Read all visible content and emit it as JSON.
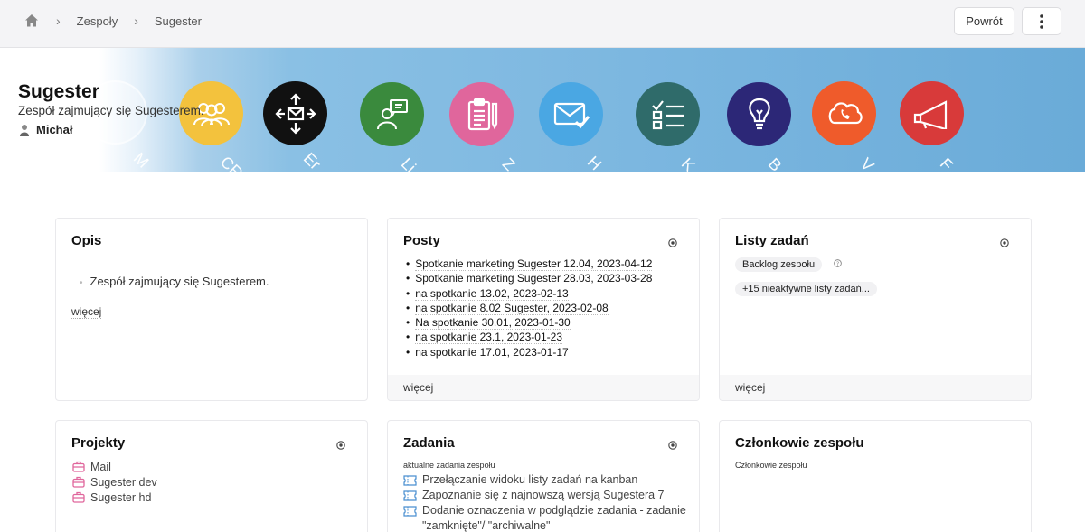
{
  "breadcrumb": {
    "home_icon": "home-icon",
    "items": [
      "Zespoły",
      "Sugester"
    ]
  },
  "toolbar": {
    "back_label": "Powrót",
    "more_icon": "more-vertical-icon"
  },
  "team": {
    "name": "Sugester",
    "description": "Zespół zajmujący się Sugesterem.",
    "owner": "Michał"
  },
  "banner": {
    "icons": [
      {
        "name": "team-icon",
        "color": "#f3c23d",
        "label": "CR"
      },
      {
        "name": "arrows-mail-icon",
        "color": "#111111",
        "label": "Er"
      },
      {
        "name": "presenter-icon",
        "color": "#3a8a3d",
        "label": "Li"
      },
      {
        "name": "clipboard-icon",
        "color": "#e0669c",
        "label": "Z"
      },
      {
        "name": "mail-check-icon",
        "color": "#4aa7e3",
        "label": "H"
      },
      {
        "name": "checklist-icon",
        "color": "#2f6b6a",
        "label": "K"
      },
      {
        "name": "bulb-icon",
        "color": "#2c2777",
        "label": "B"
      },
      {
        "name": "cloud-phone-icon",
        "color": "#ef5b2b",
        "label": "V"
      },
      {
        "name": "megaphone-icon",
        "color": "#d83a3a",
        "label": "F"
      }
    ],
    "first_label": "M"
  },
  "cards": {
    "opis": {
      "title": "Opis",
      "items": [
        "Zespół zajmujący się Sugesterem."
      ],
      "more": "więcej"
    },
    "posty": {
      "title": "Posty",
      "items": [
        "Spotkanie marketing Sugester 12.04, 2023-04-12",
        "Spotkanie marketing Sugester 28.03, 2023-03-28",
        "na spotkanie 13.02, 2023-02-13",
        "na spotkanie 8.02 Sugester, 2023-02-08",
        "Na spotkanie 30.01, 2023-01-30",
        "na spotkanie 23.1, 2023-01-23",
        "na spotkanie 17.01, 2023-01-17"
      ],
      "more": "więcej"
    },
    "listy": {
      "title": "Listy zadań",
      "backlog": "Backlog zespołu",
      "inactive": "+15 nieaktywne listy zadań...",
      "more": "więcej"
    },
    "projekty": {
      "title": "Projekty",
      "items": [
        "Mail",
        "Sugester dev",
        "Sugester hd"
      ]
    },
    "zadania": {
      "title": "Zadania",
      "subtitle": "aktualne zadania zespołu",
      "items": [
        "Przełączanie widoku listy zadań na kanban",
        "Zapoznanie się z najnowszą wersją Sugestera 7",
        "Dodanie oznaczenia w podglądzie zadania - zadanie \"zamknięte\"/ \"archiwalne\""
      ]
    },
    "czlonkowie": {
      "title": "Członkowie zespołu",
      "subtitle": "Członkowie zespołu"
    }
  },
  "colors": {
    "accent_pink": "#e0669c",
    "accent_blue": "#4a8fd0"
  }
}
